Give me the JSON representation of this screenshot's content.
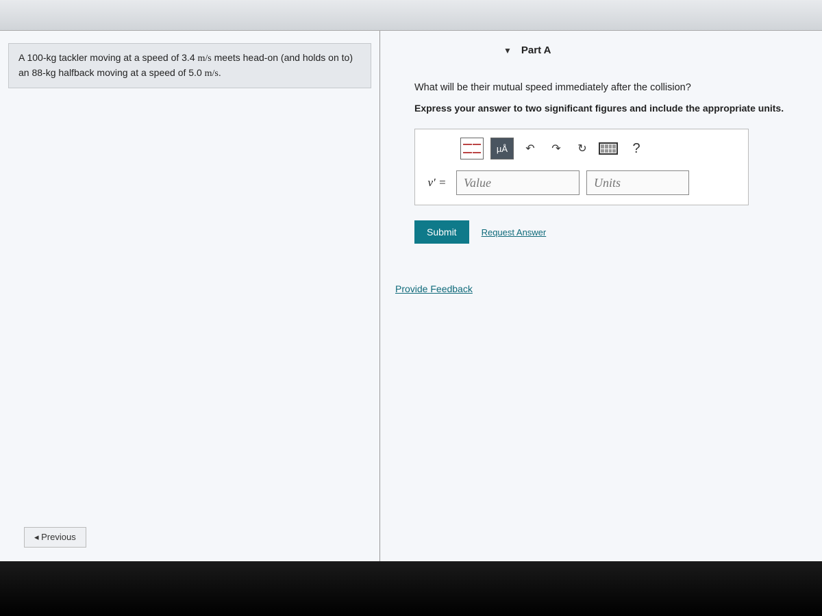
{
  "problem": {
    "text_before": "A 100-kg tackler moving at a speed of 3.4 ",
    "unit1": "m/s",
    "text_mid": " meets head-on (and holds on to) an 88-kg halfback moving at a speed of 5.0 ",
    "unit2": "m/s",
    "text_after": "."
  },
  "nav": {
    "previous": "◂ Previous"
  },
  "part": {
    "label": "Part A",
    "question": "What will be their mutual speed immediately after the collision?",
    "instruction": "Express your answer to two significant figures and include the appropriate units."
  },
  "toolbar": {
    "mua": "µÅ",
    "undo": "↶",
    "redo": "↷",
    "reset": "↻",
    "help": "?"
  },
  "input": {
    "variable": "v′ =",
    "value_placeholder": "Value",
    "units_placeholder": "Units"
  },
  "actions": {
    "submit": "Submit",
    "request": "Request Answer",
    "feedback": "Provide Feedback"
  }
}
